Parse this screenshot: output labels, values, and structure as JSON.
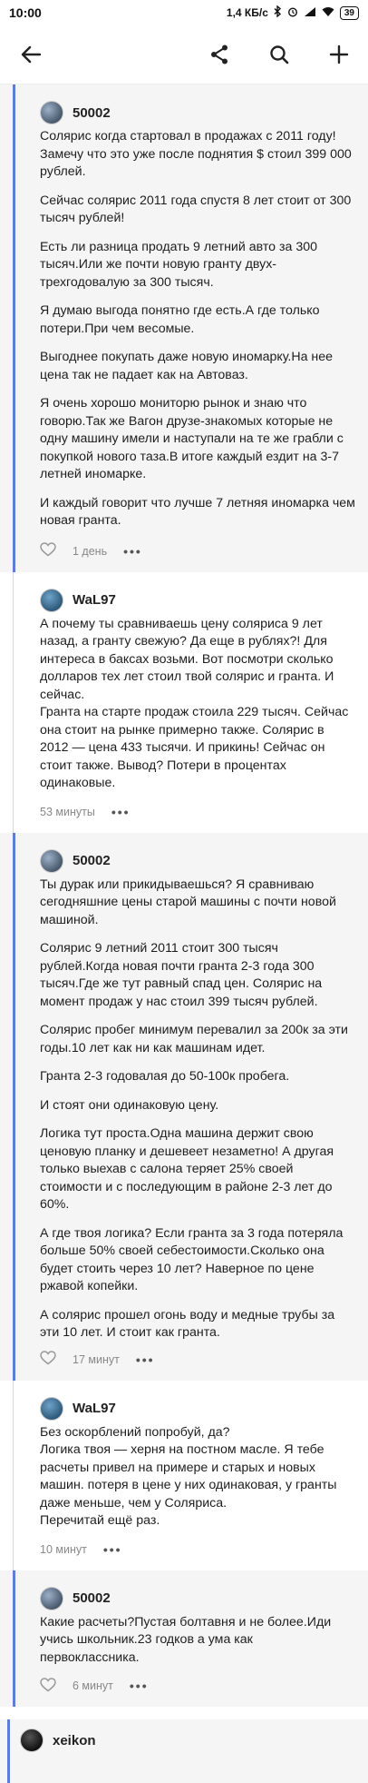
{
  "status": {
    "time": "10:00",
    "speed": "1,4 КБ/с",
    "battery": "39"
  },
  "comments": [
    {
      "author": "50002",
      "paras": [
        "Солярис когда стартовал в продажах с 2011 году!Замечу что это уже после поднятия $ стоил 399 000 рублей.",
        "Сейчас солярис 2011 года спустя 8 лет стоит от 300 тысяч рублей!",
        "Есть ли разница продать 9 летний авто за 300 тысяч.Или же почти новую гранту двух-трехгодовалую за 300 тысяч.",
        "Я думаю выгода понятно где есть.А где только потери.При чем весомые.",
        "Выгоднее покупать даже новую иномарку.На нее цена так не падает как на Автоваз.",
        "Я очень хорошо мониторю рынок и знаю что говорю.Так же Вагон друзе-знакомых которые не одну машину имели и наступали на те же грабли с покупкой нового таза.В итоге каждый ездит на 3-7 летней иномарке.",
        "И каждый говорит что лучше 7 летняя иномарка чем новая гранта."
      ],
      "time": "1 день"
    },
    {
      "author": "WaL97",
      "text": "А почему ты сравниваешь цену соляриса 9 лет назад, а гранту свежую? Да еще в рублях?! Для интереса в баксах возьми. Вот посмотри сколько долларов тех лет стоил твой солярис и гранта. И сейчас.\nГранта на старте продаж стоила 229 тысяч. Сейчас она стоит на рынке примерно также. Солярис в 2012 — цена 433 тысячи. И прикинь! Сейчас он стоит также. Вывод? Потери в процентах одинаковые.",
      "time": "53 минуты"
    },
    {
      "author": "50002",
      "paras": [
        "Ты дурак или прикидываешься? Я сравниваю сегодняшние цены старой машины с почти новой машиной.",
        "Солярис 9 летний 2011 стоит 300 тысяч рублей.Когда новая почти гранта 2-3 года 300 тысяч.Где же тут равный спад цен. Солярис на момент продаж у нас стоил 399 тысяч рублей.",
        "Солярис пробег минимум перевалил за 200к за эти годы.10 лет как ни как машинам идет.",
        "Гранта 2-3 годовалая до 50-100к пробега.",
        "И стоят они одинаковую цену.",
        "Логика тут проста.Одна машина держит свою ценовую планку и дешевеет незаметно! А другая только выехав с салона теряет 25% своей стоимости и с последующим в районе 2-3 лет до 60%.",
        "А где твоя логика? Если гранта за 3 года потеряла больше 50% своей себестоимости.Сколько она будет стоить через 10 лет? Наверное по цене ржавой копейки.",
        "А солярис прошел огонь воду и медные трубы за эти 10 лет. И стоит как гранта."
      ],
      "time": "17 минут"
    },
    {
      "author": "WaL97",
      "text": "Без оскорблений попробуй, да?\nЛогика твоя — херня на постном масле. Я тебе расчеты привел на примере и старых и новых машин. потеря в цене у них одинаковая, у гранты даже меньше, чем у Соляриса.\nПеречитай ещё раз.",
      "time": "10 минут"
    },
    {
      "author": "50002",
      "text": "Какие расчеты?Пустая болтавня и не более.Иди учись школьник.23 годков а ума как первоклассника.",
      "time": "6 минут"
    }
  ],
  "last_author": "xeikon"
}
